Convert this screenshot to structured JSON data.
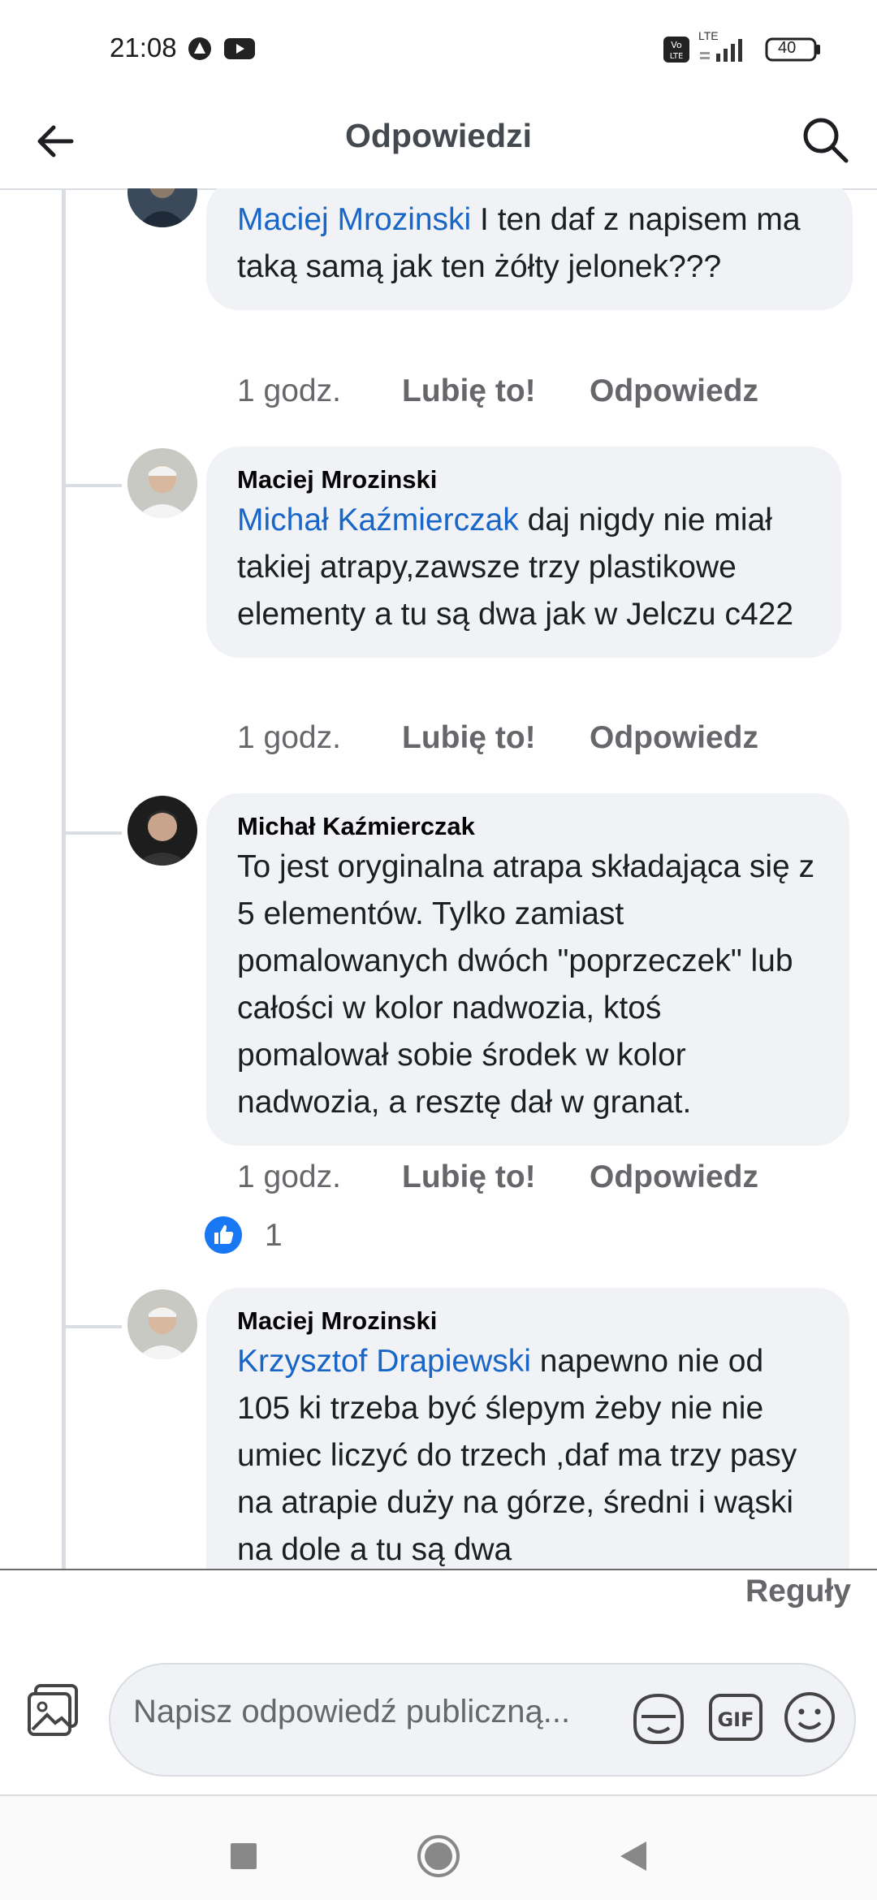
{
  "status_bar": {
    "time": "21:08",
    "battery": "40",
    "network": "LTE",
    "icons": [
      "vpn-icon",
      "youtube-icon",
      "volte-icon",
      "signal-icon",
      "battery-icon"
    ]
  },
  "header": {
    "title": "Odpowiedzi",
    "icons": [
      "back-arrow-icon",
      "search-icon"
    ]
  },
  "comments": [
    {
      "mention": "Maciej Mrozinski",
      "text": " I ten daf z napisem ma taką samą jak ten żółty jelonek???",
      "time": "1 godz.",
      "like": "Lubię to!",
      "reply": "Odpowiedz"
    },
    {
      "author": "Maciej Mrozinski",
      "mention": "Michał Kaźmierczak",
      "text": " daj nigdy nie miał takiej atrapy,zawsze trzy plastikowe elementy a tu są dwa jak w Jelczu c422",
      "time": "1 godz.",
      "like": "Lubię to!",
      "reply": "Odpowiedz"
    },
    {
      "author": "Michał Kaźmierczak",
      "text": "To jest oryginalna atrapa składająca się z 5 elementów. Tylko zamiast pomalowanych dwóch \"poprzeczek\" lub całości w kolor nadwozia, ktoś pomalował sobie środek w kolor nadwozia, a resztę dał w granat.",
      "time": "1 godz.",
      "like": "Lubię to!",
      "reply": "Odpowiedz",
      "reaction_count": "1"
    },
    {
      "author": "Maciej Mrozinski",
      "mention": "Krzysztof Drapiewski",
      "text": " napewno nie od 105 ki trzeba być ślepym żeby nie nie umiec liczyć do trzech ,daf ma trzy pasy na atrapie duży na górze, średni i wąski na dole a tu są dwa"
    }
  ],
  "footer": {
    "rules": "Reguły",
    "input_placeholder": "Napisz odpowiedź publiczną...",
    "icons": [
      "photo-icon",
      "sticker-icon",
      "gif-icon",
      "emoji-icon"
    ]
  },
  "nav": {
    "icons": [
      "recent-apps-icon",
      "home-icon",
      "back-icon"
    ]
  },
  "colors": {
    "mention": "#1866c7",
    "bubble": "#f0f2f5",
    "secondary_text": "#65676b",
    "like_blue": "#1877f2"
  }
}
